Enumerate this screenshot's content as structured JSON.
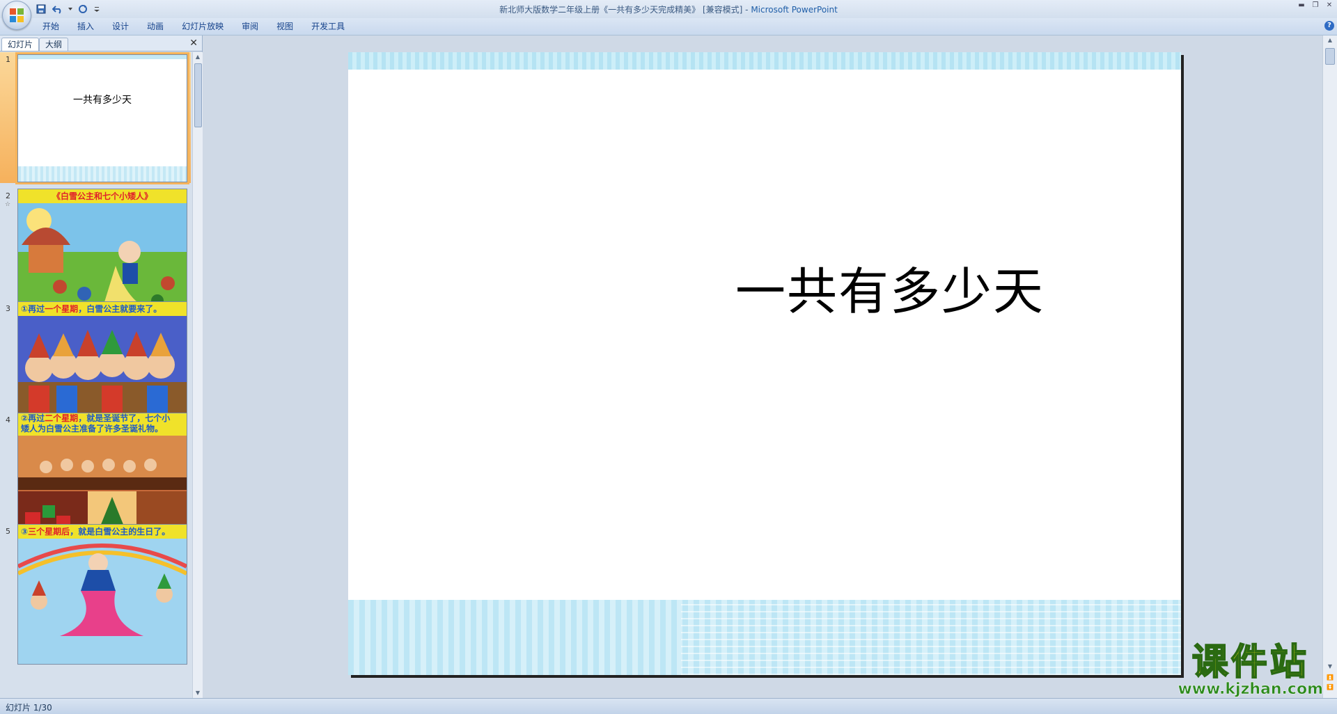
{
  "titlebar": {
    "document": "新北师大版数学二年级上册《一共有多少天完成精美》 [兼容模式] -",
    "app": "Microsoft PowerPoint"
  },
  "ribbon": {
    "tabs": [
      "开始",
      "插入",
      "设计",
      "动画",
      "幻灯片放映",
      "审阅",
      "视图",
      "开发工具"
    ]
  },
  "pane": {
    "tab_slides": "幻灯片",
    "tab_outline": "大纲"
  },
  "thumbnails": [
    {
      "num": "1",
      "title": "一共有多少天"
    },
    {
      "num": "2",
      "caption": "《白雪公主和七个小矮人》"
    },
    {
      "num": "3",
      "caption_a": "①再过",
      "caption_b": "一个星期",
      "caption_c": "，白雪公主就要来了。"
    },
    {
      "num": "4",
      "caption_a": "②再过",
      "caption_b": "二个星期",
      "caption_c": "，就是圣诞节了，七个小",
      "caption_d": "矮人为白雪公主准备了许多圣诞礼物。"
    },
    {
      "num": "5",
      "caption_a": "③",
      "caption_b": "三个星期后",
      "caption_c": "，就是白雪公主的生日了。"
    }
  ],
  "slide": {
    "title": "一共有多少天"
  },
  "watermark": {
    "big": "课件站",
    "url": "www.kjzhan.com"
  },
  "status": {
    "slide_counter": "幻灯片 1/30"
  },
  "colors": {
    "accent": "#1f5ea8",
    "selection": "#f6b15c"
  }
}
